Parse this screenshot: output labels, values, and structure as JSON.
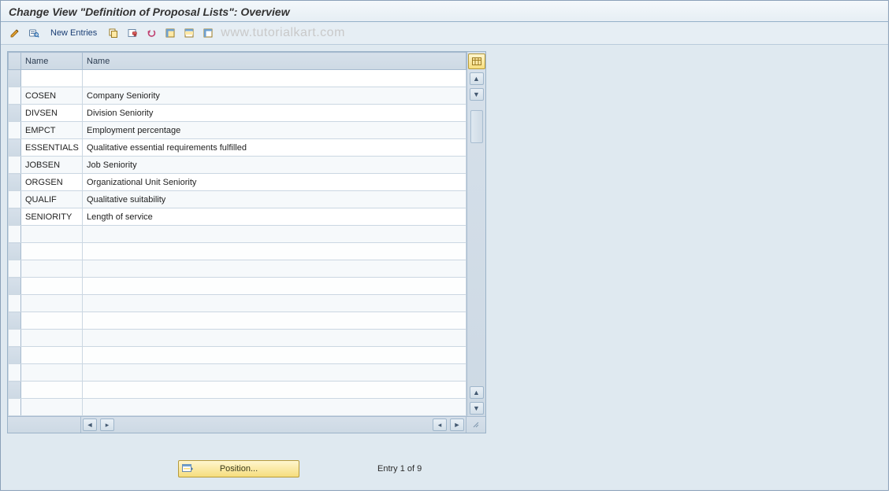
{
  "window_title": "Change View \"Definition of Proposal Lists\": Overview",
  "toolbar": {
    "new_entries_label": "New Entries",
    "icons": {
      "display_change": "display-change-icon",
      "find": "find-icon",
      "copy": "copy-icon",
      "delete": "delete-icon",
      "undo": "undo-icon",
      "select_all": "select-all-icon",
      "select_block": "select-block-icon",
      "deselect_all": "deselect-all-icon"
    }
  },
  "watermark_text": "www.tutorialkart.com",
  "table": {
    "columns": [
      "Name",
      "Name"
    ],
    "rows": [
      {
        "code": "",
        "desc": ""
      },
      {
        "code": "COSEN",
        "desc": "Company Seniority"
      },
      {
        "code": "DIVSEN",
        "desc": "Division Seniority"
      },
      {
        "code": "EMPCT",
        "desc": "Employment percentage"
      },
      {
        "code": "ESSENTIALS",
        "desc": "Qualitative essential requirements fulfilled"
      },
      {
        "code": "JOBSEN",
        "desc": "Job Seniority"
      },
      {
        "code": "ORGSEN",
        "desc": "Organizational Unit Seniority"
      },
      {
        "code": "QUALIF",
        "desc": "Qualitative suitability"
      },
      {
        "code": "SENIORITY",
        "desc": "Length of service"
      }
    ],
    "empty_rows": 11
  },
  "position_button_label": "Position...",
  "entry_status": "Entry 1 of 9"
}
